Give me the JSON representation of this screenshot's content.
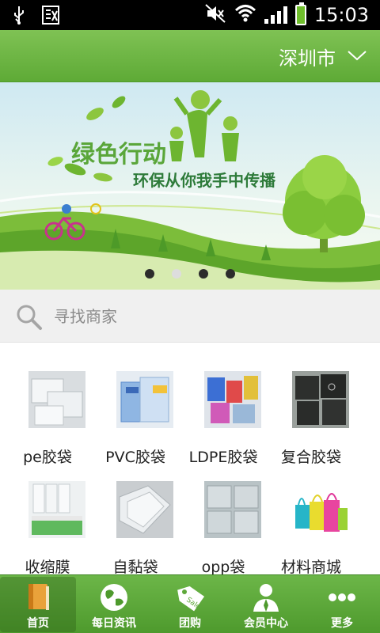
{
  "status_bar": {
    "time": "15:03"
  },
  "header": {
    "city": "深圳市"
  },
  "banner": {
    "title": "绿色行动",
    "subtitle": "环保从你我手中传播",
    "pages": 4,
    "active_page": 2
  },
  "search": {
    "placeholder": "寻找商家"
  },
  "categories": [
    {
      "label": "pe胶袋"
    },
    {
      "label": "PVC胶袋"
    },
    {
      "label": "LDPE胶袋"
    },
    {
      "label": "复合胶袋"
    },
    {
      "label": "收缩膜"
    },
    {
      "label": "自黏袋"
    },
    {
      "label": "opp袋"
    },
    {
      "label": "材料商城"
    }
  ],
  "tabs": [
    {
      "label": "首页",
      "icon": "book-icon"
    },
    {
      "label": "每日资讯",
      "icon": "globe-icon"
    },
    {
      "label": "团购",
      "icon": "sale-tag-icon"
    },
    {
      "label": "会员中心",
      "icon": "member-icon"
    },
    {
      "label": "更多",
      "icon": "more-icon"
    }
  ],
  "colors": {
    "brand_green": "#5eaa36",
    "tab_green": "#4e9a2d"
  }
}
